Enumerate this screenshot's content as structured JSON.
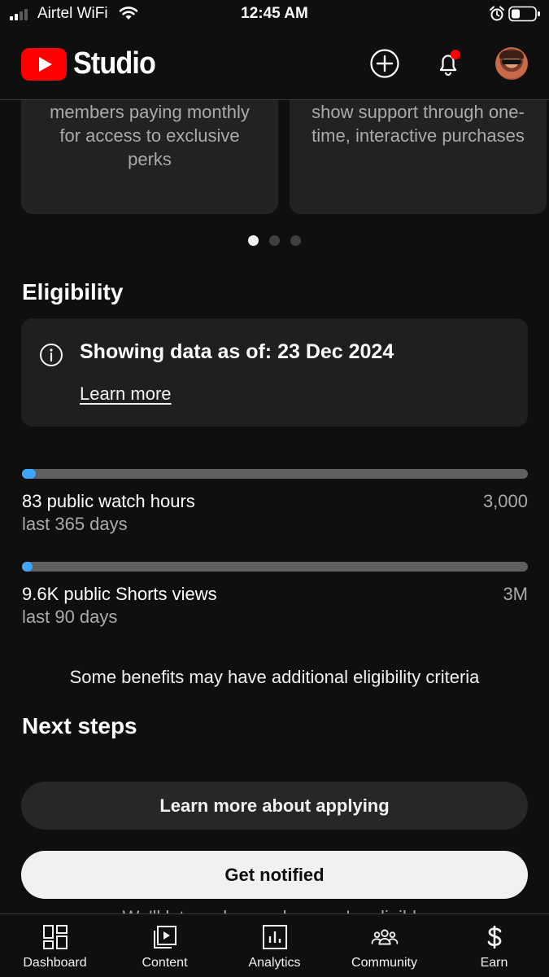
{
  "status_bar": {
    "carrier": "Airtel WiFi",
    "time": "12:45 AM"
  },
  "header": {
    "logo_text": "Studio",
    "logo_color": "#ff0000",
    "notification_dot_color": "#ff0000"
  },
  "promo_cards": [
    {
      "text": "members paying monthly for access to exclusive perks"
    },
    {
      "text": "show support through one-time, interactive purchases"
    }
  ],
  "carousel": {
    "count": 3,
    "active_index": 0
  },
  "eligibility": {
    "title": "Eligibility",
    "info_text": "Showing data as of: 23 Dec 2024",
    "learn_more": "Learn more",
    "metrics": [
      {
        "label": "83 public watch hours",
        "target": "3,000",
        "period": "last 365 days",
        "progress_fraction": 0.028
      },
      {
        "label": "9.6K public Shorts views",
        "target": "3M",
        "period": "last 90 days",
        "progress_fraction": 0.0032
      }
    ],
    "note": "Some benefits may have additional eligibility criteria"
  },
  "next_steps": {
    "title": "Next steps",
    "learn_more_applying": "Learn more about applying",
    "get_notified": "Get notified",
    "footer_peek": "We'll let you know when you're eligible"
  },
  "bottom_nav": [
    {
      "label": "Dashboard",
      "icon": "dashboard-icon"
    },
    {
      "label": "Content",
      "icon": "content-icon"
    },
    {
      "label": "Analytics",
      "icon": "analytics-icon"
    },
    {
      "label": "Community",
      "icon": "community-icon"
    },
    {
      "label": "Earn",
      "icon": "earn-icon"
    }
  ],
  "colors": {
    "background": "#0f0f0f",
    "progress_fill": "#3ea6ff",
    "progress_track": "#606060"
  }
}
